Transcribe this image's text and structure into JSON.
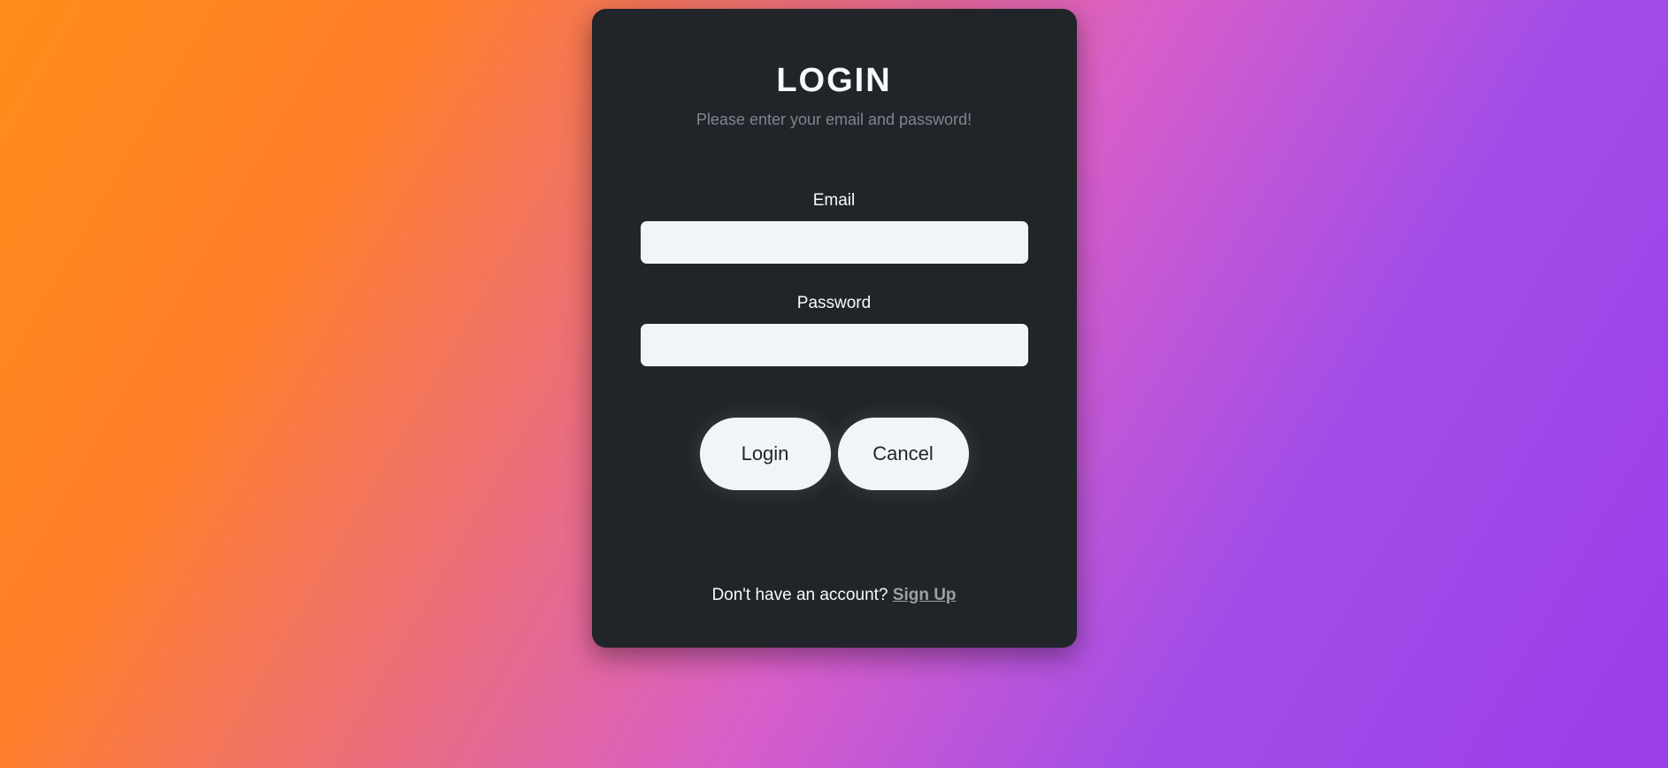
{
  "card": {
    "title": "LOGIN",
    "subtitle": "Please enter your email and password!",
    "email_label": "Email",
    "email_value": "",
    "password_label": "Password",
    "password_value": "",
    "login_button": "Login",
    "cancel_button": "Cancel",
    "footer_text": "Don't have an account? ",
    "signup_link": "Sign Up"
  }
}
